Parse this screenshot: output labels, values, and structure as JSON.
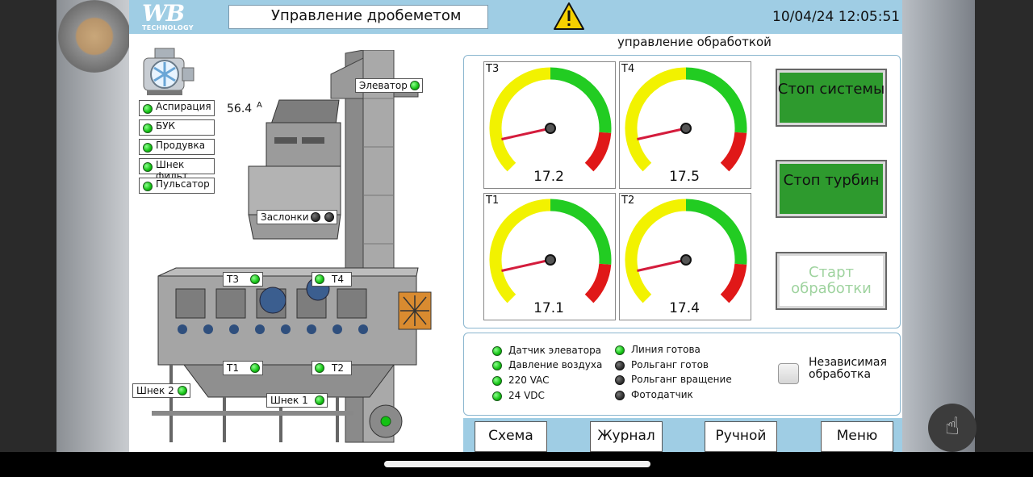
{
  "header": {
    "logo_text": "WB",
    "logo_subtext": "TECHNOLOGY",
    "title": "Управление дробеметом",
    "alarm_icon": "warning-triangle-icon",
    "datetime": "10/04/24 12:05:51"
  },
  "section_label": "управление  обработкой",
  "aspiration": {
    "icon": "fan-icon",
    "current_value": "56.4",
    "current_unit": "A",
    "items": [
      {
        "label": "Аспирация",
        "state": "on"
      },
      {
        "label": "БУК",
        "state": "on"
      },
      {
        "label": "Продувка",
        "state": "on"
      },
      {
        "label": "Шнек фильт",
        "state": "on"
      },
      {
        "label": "Пульсатор",
        "state": "on"
      }
    ]
  },
  "machine_tags": {
    "elevator": "Элеватор",
    "dampers": "Заслонки",
    "t3": "T3",
    "t4": "T4",
    "t1": "T1",
    "t2": "T2",
    "screw2": "Шнек 2",
    "screw1": "Шнек 1"
  },
  "gauges": [
    {
      "label": "T3",
      "value": "17.2",
      "fraction": 0.12
    },
    {
      "label": "T4",
      "value": "17.5",
      "fraction": 0.12
    },
    {
      "label": "T1",
      "value": "17.1",
      "fraction": 0.12
    },
    {
      "label": "T2",
      "value": "17.4",
      "fraction": 0.12
    }
  ],
  "controls": {
    "stop_system": "Стоп системы",
    "stop_turbines": "Стоп турбин",
    "start_processing": "Старт обработки"
  },
  "indicators": {
    "left": [
      {
        "label": "Датчик элеватора",
        "state": "on"
      },
      {
        "label": "Давление воздуха",
        "state": "on"
      },
      {
        "label": "220 VAC",
        "state": "on"
      },
      {
        "label": "24 VDC",
        "state": "on"
      }
    ],
    "right": [
      {
        "label": "Линия готова",
        "state": "on"
      },
      {
        "label": "Рольганг готов",
        "state": "off"
      },
      {
        "label": "Рольганг вращение",
        "state": "off"
      },
      {
        "label": "Фотодатчик",
        "state": "off"
      }
    ],
    "independent_label": "Независимая обработка",
    "independent_checked": false
  },
  "nav": {
    "schema": "Схема",
    "journal": "Журнал",
    "manual": "Ручной",
    "menu": "Меню"
  },
  "colors": {
    "header_bg": "#9fcde4",
    "gauge_yellow": "#f2f200",
    "gauge_green": "#22cc22",
    "gauge_red": "#e01818",
    "button_green": "#2e9a2e",
    "led_on": "#13c213"
  }
}
